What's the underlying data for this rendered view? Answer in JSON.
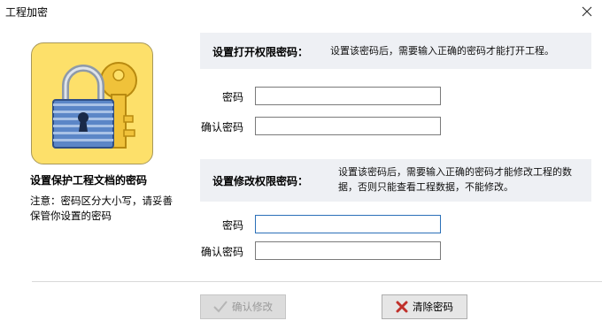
{
  "window": {
    "title": "工程加密"
  },
  "left": {
    "heading": "设置保护工程文档的密码",
    "note": "注意：密码区分大小写，请妥善保管你设置的密码",
    "logo_icon": "lock-key-icon"
  },
  "open_section": {
    "title": "设置打开权限密码：",
    "description": "设置该密码后，需要输入正确的密码才能打开工程。",
    "password_label": "密码",
    "password_value": "",
    "confirm_label": "确认密码",
    "confirm_value": ""
  },
  "modify_section": {
    "title": "设置修改权限密码：",
    "description": "设置该密码后，需要输入正确的密码才能修改工程的数据，否则只能查看工程数据，不能修改。",
    "password_label": "密码",
    "password_value": "",
    "confirm_label": "确认密码",
    "confirm_value": ""
  },
  "buttons": {
    "confirm_label": "确认修改",
    "confirm_enabled": false,
    "clear_label": "清除密码"
  },
  "colors": {
    "logo_bg": "#fde06a",
    "section_bg": "#eef0f4",
    "clear_icon": "#c0302a"
  }
}
